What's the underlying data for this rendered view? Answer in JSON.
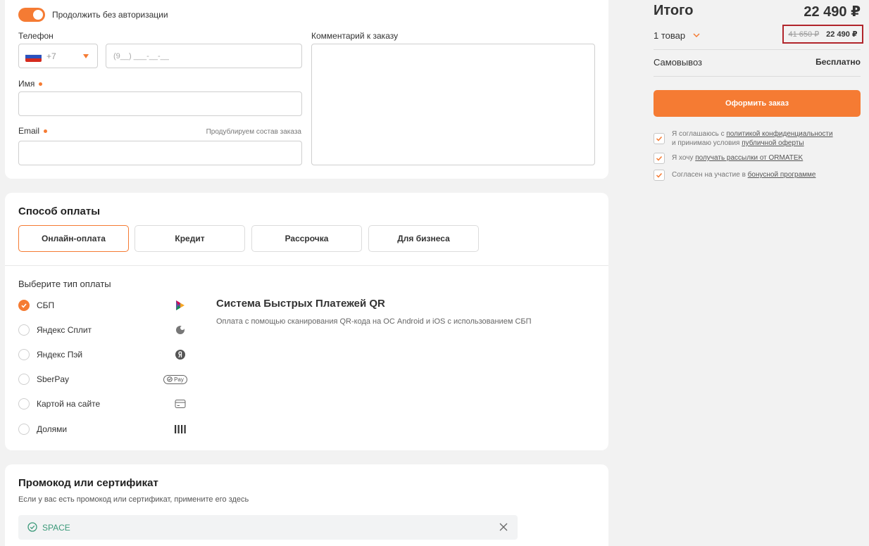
{
  "contact": {
    "continue_without_auth": "Продолжить без авторизации",
    "phone_label": "Телефон",
    "phone_code": "+7",
    "phone_placeholder": "(9__) ___-__-__",
    "name_label": "Имя",
    "email_label": "Email",
    "email_hint": "Продублируем состав заказа",
    "comment_label": "Комментарий к заказу"
  },
  "payment": {
    "title": "Способ оплаты",
    "tabs": [
      "Онлайн-оплата",
      "Кредит",
      "Рассрочка",
      "Для бизнеса"
    ],
    "active_tab": "Онлайн-оплата",
    "choose_label": "Выберите тип оплаты",
    "options": [
      {
        "label": "СБП",
        "icon": "sbp-icon",
        "selected": true
      },
      {
        "label": "Яндекс Сплит",
        "icon": "yandex-split-icon",
        "selected": false
      },
      {
        "label": "Яндекс Пэй",
        "icon": "yandex-pay-icon",
        "selected": false
      },
      {
        "label": "SberPay",
        "icon": "sberpay-icon",
        "icon_text": "Pay",
        "selected": false
      },
      {
        "label": "Картой на сайте",
        "icon": "card-icon",
        "selected": false
      },
      {
        "label": "Долями",
        "icon": "dolyami-icon",
        "selected": false
      }
    ],
    "selected_title": "Система Быстрых Платежей QR",
    "selected_desc": "Оплата с помощью сканирования QR-кода на ОС Android и iOS с использованием СБП"
  },
  "promo": {
    "title": "Промокод или сертификат",
    "desc": "Если у вас есть промокод или сертификат, примените его здесь",
    "code": "SPACE"
  },
  "summary": {
    "total_label": "Итого",
    "total_value": "22 490 ₽",
    "items_count": "1 товар",
    "old_price": "41 650 ₽",
    "new_price": "22 490 ₽",
    "delivery_label": "Самовывоз",
    "delivery_value": "Бесплатно",
    "checkout_label": "Оформить заказ",
    "agreements": [
      {
        "pre": "Я соглашаюсь с ",
        "link1": "политикой конфиденциальности",
        "mid": "и принимаю условия ",
        "link2": "публичной оферты"
      },
      {
        "pre": "Я хочу ",
        "link1": "получать рассылки от ORMATEK"
      },
      {
        "pre": "Согласен на участие в ",
        "link1": "бонусной программе"
      }
    ]
  },
  "colors": {
    "accent": "#f57b33",
    "highlight_border": "#b1252b",
    "promo_success": "#3c9a7a"
  }
}
